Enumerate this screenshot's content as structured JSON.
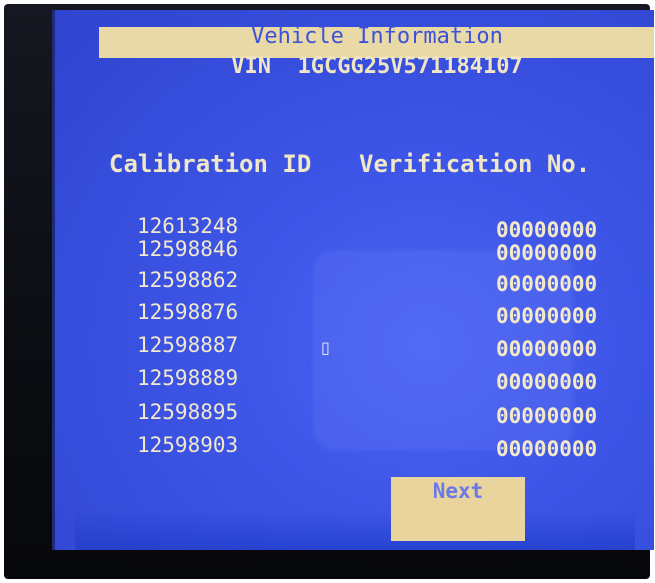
{
  "header": {
    "title": "Vehicle Information",
    "vin_label": "VIN",
    "vin_value": "1GCGG25V571184107"
  },
  "table": {
    "columns": [
      "Calibration ID",
      "Verification No."
    ],
    "rows": [
      {
        "calibration_id": "12613248",
        "verification_no": "00000000"
      },
      {
        "calibration_id": "12598846",
        "verification_no": "00000000"
      },
      {
        "calibration_id": "12598862",
        "verification_no": "00000000"
      },
      {
        "calibration_id": "12598876",
        "verification_no": "00000000"
      },
      {
        "calibration_id": "12598887",
        "verification_no": "00000000"
      },
      {
        "calibration_id": "12598889",
        "verification_no": "00000000"
      },
      {
        "calibration_id": "12598895",
        "verification_no": "00000000"
      },
      {
        "calibration_id": "12598903",
        "verification_no": "00000000"
      }
    ]
  },
  "footer": {
    "next_label": "Next"
  },
  "colors": {
    "screen_bg": "#3d55e6",
    "header_bar": "#e8d9a6",
    "title_text": "#3c52d8",
    "table_text": "#f2e8cc",
    "button_bg": "#e9d49e",
    "button_text": "#6b79e8"
  },
  "icons": {
    "cursor": "mouse-pointer-icon"
  }
}
